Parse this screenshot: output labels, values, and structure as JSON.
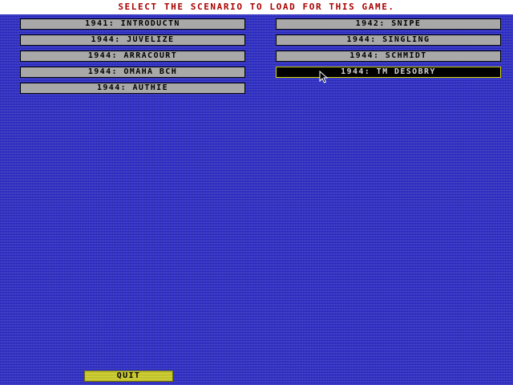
{
  "header": {
    "title": "SELECT THE SCENARIO TO LOAD FOR THIS GAME."
  },
  "scenarios": {
    "left": [
      {
        "label": "1941: INTRODUCTN",
        "selected": false
      },
      {
        "label": "1944: JUVELIZE",
        "selected": false
      },
      {
        "label": "1944: ARRACOURT",
        "selected": false
      },
      {
        "label": "1944: OMAHA BCH",
        "selected": false
      },
      {
        "label": "1944: AUTHIE",
        "selected": false
      }
    ],
    "right": [
      {
        "label": "1942: SNIPE",
        "selected": false
      },
      {
        "label": "1944: SINGLING",
        "selected": false
      },
      {
        "label": "1944: SCHMIDT",
        "selected": false
      },
      {
        "label": "1944: TM DESOBRY",
        "selected": true
      }
    ]
  },
  "quit": {
    "label": "QUIT"
  },
  "colors": {
    "header_text": "#a80000",
    "background": "#2828c8",
    "button": "#a8a8a8",
    "selected_button": "#000000",
    "selected_border": "#d4d400",
    "quit_button": "#d8d83c"
  },
  "icons": {
    "pointer": "mouse-pointer-icon"
  }
}
